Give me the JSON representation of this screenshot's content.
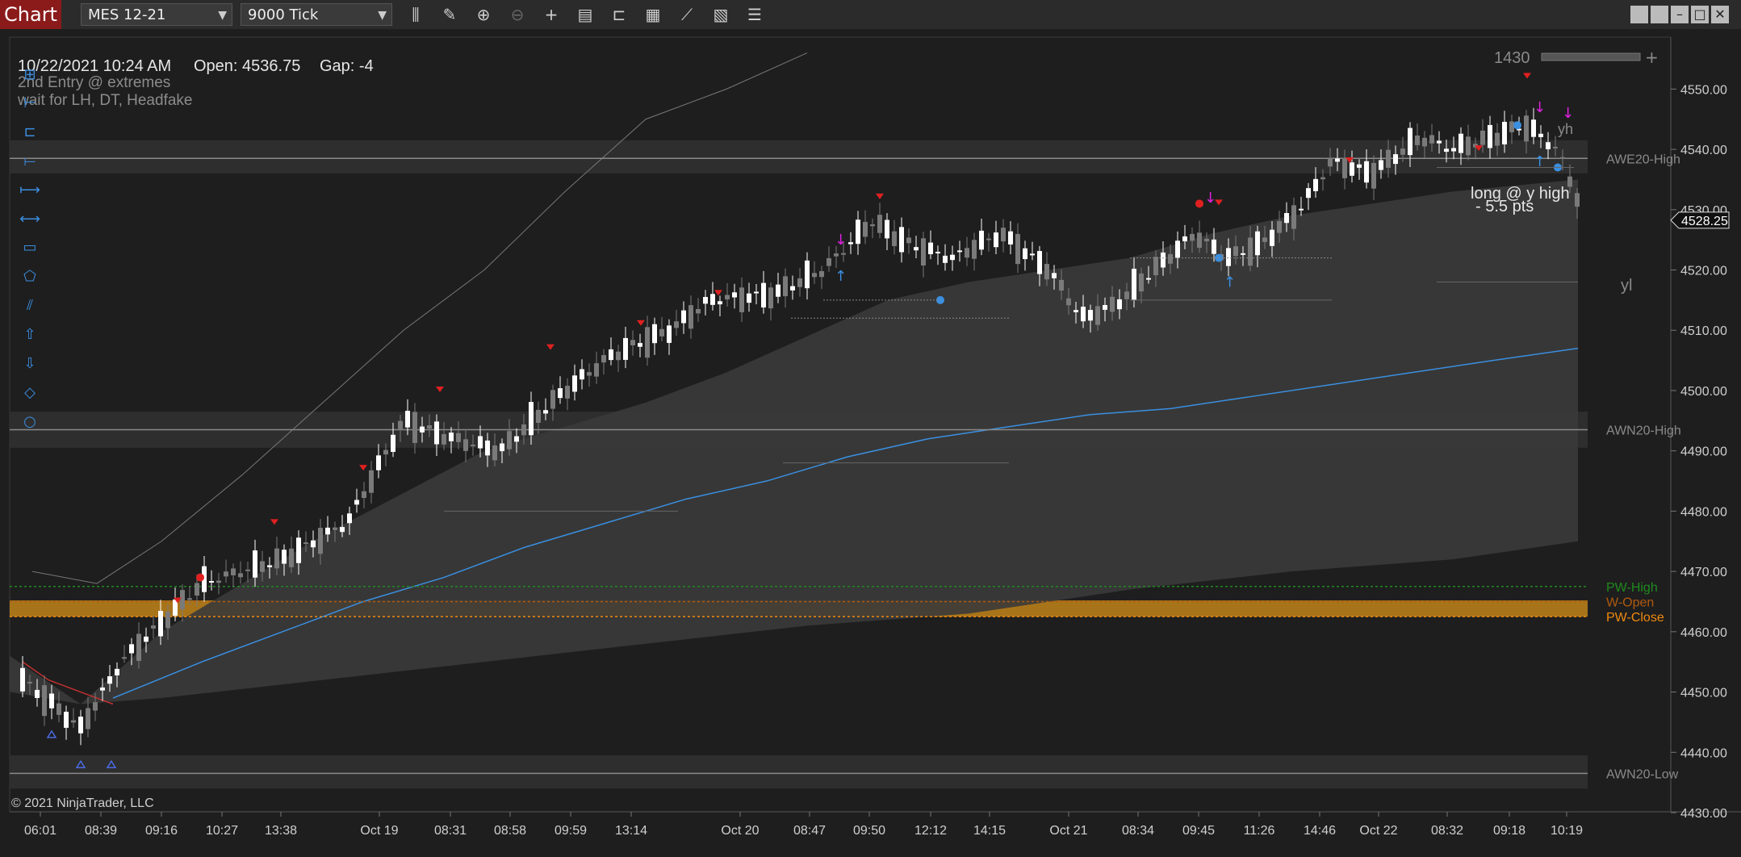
{
  "window": {
    "title": "Chart",
    "instrument": "MES 12-21",
    "timeframe": "9000 Tick",
    "toolbar_icons": [
      "bar-type-icon",
      "pencil-icon",
      "zoom-in-icon",
      "zoom-out-icon",
      "crosshair-icon",
      "data-box-icon",
      "properties-icon",
      "strategies-icon",
      "indicators-icon",
      "script-icon",
      "list-icon"
    ],
    "window_buttons": [
      "tile-icon",
      "tile-icon-2",
      "minimize-icon",
      "maximize-icon",
      "close-icon"
    ]
  },
  "info": {
    "datetime": "10/22/2021 10:24 AM",
    "open_label": "Open: 4536.75",
    "gap_label": "Gap: -4",
    "note_1": "2nd Entry @ extremes",
    "note_2": "wait for LH, DT, Headfake"
  },
  "annotation": {
    "line1": "long @ y high",
    "line2": "- 5.5 pts",
    "yh": "yh",
    "yl": "yl"
  },
  "bar_counter": "1430",
  "copyright": "© 2021 NinjaTrader, LLC",
  "current_price": "4528.25",
  "price_axis": {
    "min": 4430,
    "max": 4555,
    "ticks": [
      "4550.00",
      "4540.00",
      "4530.00",
      "4520.00",
      "4510.00",
      "4500.00",
      "4490.00",
      "4480.00",
      "4470.00",
      "4460.00",
      "4450.00",
      "4440.00",
      "4430.00"
    ]
  },
  "time_axis": [
    "06:01",
    "08:39",
    "09:16",
    "10:27",
    "13:38",
    "Oct 19",
    "08:31",
    "08:58",
    "09:59",
    "13:14",
    "Oct 20",
    "08:47",
    "09:50",
    "12:12",
    "14:15",
    "Oct 21",
    "08:34",
    "09:45",
    "11:26",
    "14:46",
    "Oct 22",
    "08:32",
    "09:18",
    "10:19"
  ],
  "level_labels": [
    {
      "text": "AWE20-High",
      "price": 4538.5,
      "color": "#8a8a8a"
    },
    {
      "text": "AWN20-High",
      "price": 4493.5,
      "color": "#8a8a8a"
    },
    {
      "text": "PW-High",
      "price": 4467.5,
      "color": "#1f8a1f"
    },
    {
      "text": "W-Open",
      "price": 4465.0,
      "color": "#b05a10"
    },
    {
      "text": "PW-Close",
      "price": 4462.5,
      "color": "#f08a10"
    },
    {
      "text": "AWN20-Low",
      "price": 4436.5,
      "color": "#8a8a8a"
    }
  ],
  "drawing_tools": [
    "draw-line-icon",
    "ruler-icon",
    "horizontal-line-icon",
    "ray-icon",
    "extended-line-icon",
    "rectangle-icon",
    "polygon-icon",
    "parallel-lines-icon",
    "arrow-up-icon",
    "arrow-down-icon",
    "diamond-icon",
    "ellipse-icon"
  ],
  "colors": {
    "background": "#1e1e1e",
    "bull_candle": "#ffffff",
    "bear_candle": "#7a7a7a",
    "vwap_line": "#3a8fe0",
    "band_fill": "#3a3a3a",
    "marker_red": "#e02020",
    "marker_magenta": "#e020e0",
    "marker_blue": "#3a8fe0"
  }
}
